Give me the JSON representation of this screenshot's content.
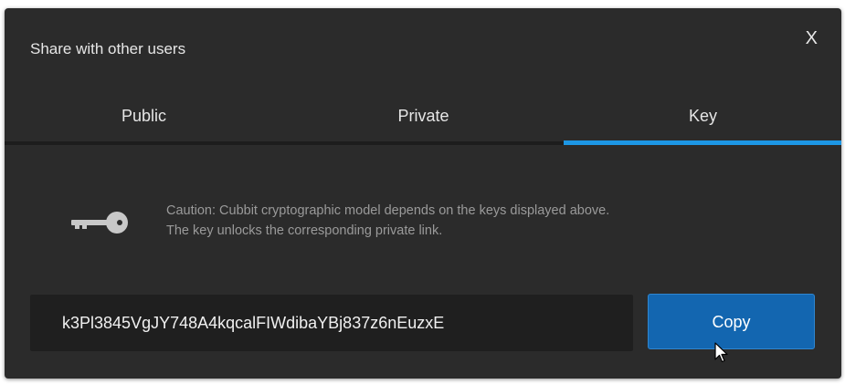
{
  "dialog": {
    "title": "Share with other users",
    "close_label": "X"
  },
  "tabs": [
    {
      "label": "Public",
      "active": false
    },
    {
      "label": "Private",
      "active": false
    },
    {
      "label": "Key",
      "active": true
    }
  ],
  "key_panel": {
    "icon": "key-icon",
    "caution_line1": "Caution: Cubbit cryptographic model depends on the keys displayed above.",
    "caution_line2": "The key unlocks the corresponding private link.",
    "key_value": "k3Pl3845VgJY748A4kqcalFIWdibaYBj837z6nEuzxE",
    "copy_label": "Copy"
  },
  "colors": {
    "background": "#2b2b2b",
    "accent": "#1d97e5",
    "button": "#1366b0"
  }
}
